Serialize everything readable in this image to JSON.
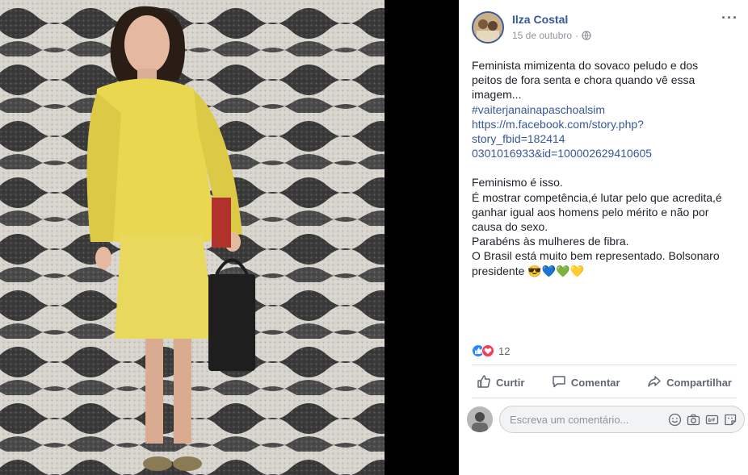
{
  "post": {
    "author": "Ilza Costal",
    "date": "15 de outubro",
    "privacy_icon": "globe-icon",
    "more_label": "···",
    "text_block_1": "Feminista mimizenta do sovaco peludo e dos\npeitos de fora senta e chora quando vê essa\nimagem...",
    "hashtag": "#vaiterjanainapaschoalsim",
    "link": "https://m.facebook.com/story.php?\nstory_fbid=182414\n0301016933&id=100002629410605",
    "text_block_2": "Feminismo é isso.\nÉ mostrar competência,é lutar pelo que acredita,é\nganhar igual aos homens pelo mérito e não por\ncausa do sexo.\nParabéns às mulheres de fibra.\nO Brasil está muito bem representado. Bolsonaro\npresidente 😎💙💚💛"
  },
  "reactions": {
    "icons": [
      "like-icon",
      "love-icon"
    ],
    "count": "12"
  },
  "actions": {
    "like": "Curtir",
    "comment": "Comentar",
    "share": "Compartilhar"
  },
  "comment_box": {
    "placeholder": "Escreva um comentário...",
    "icons": [
      "emoji-icon",
      "camera-icon",
      "gif-icon",
      "sticker-icon"
    ]
  },
  "colors": {
    "link": "#365899",
    "text": "#1d2129",
    "meta": "#90949c",
    "dress": "#e8d85c",
    "background": "#000000"
  }
}
